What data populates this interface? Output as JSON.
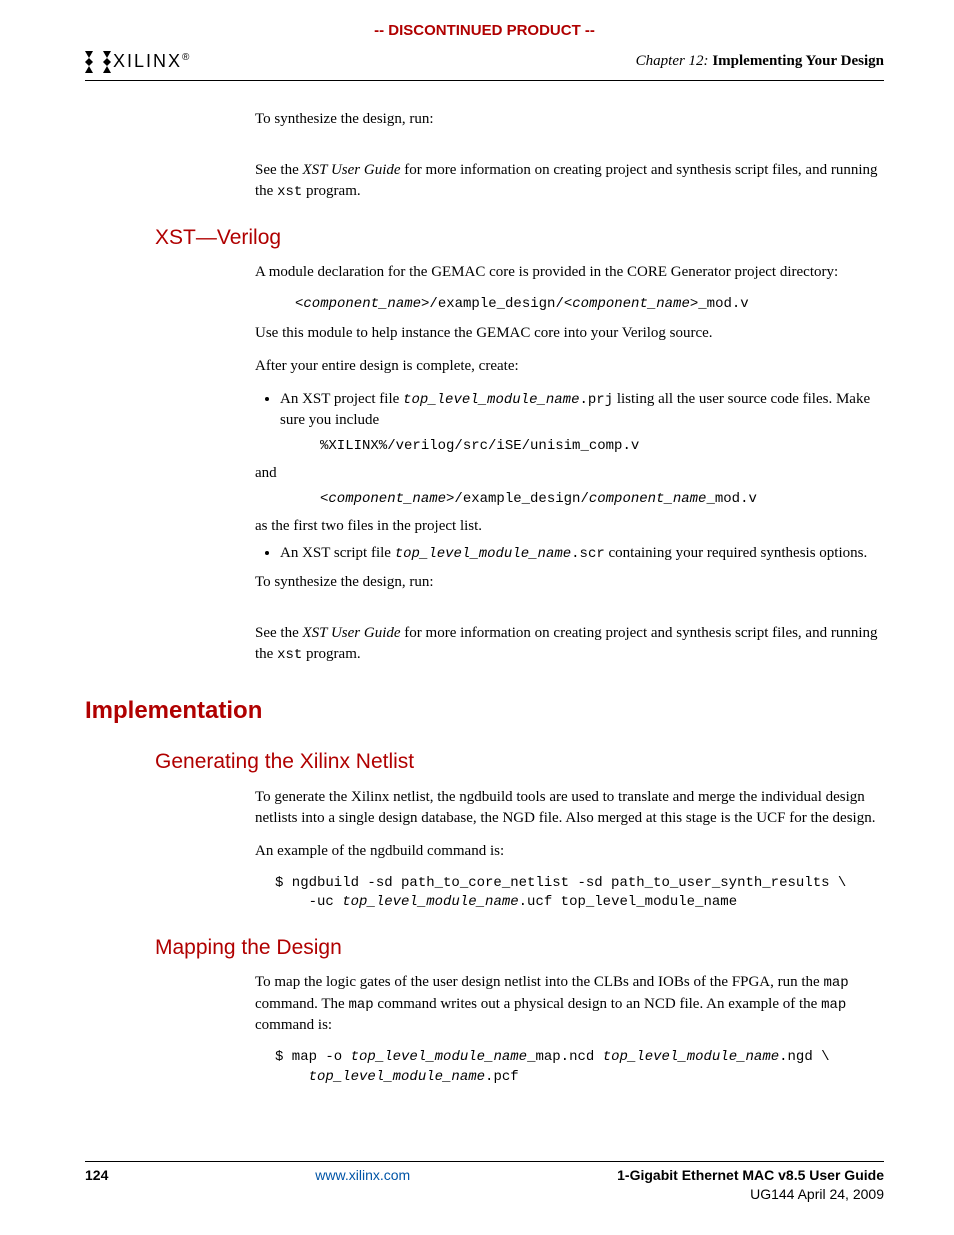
{
  "banner": "-- DISCONTINUED PRODUCT --",
  "logo_text": "XILINX",
  "chapter_prefix": "Chapter 12:",
  "chapter_title": "Implementing Your Design",
  "p_synth_intro": "To synthesize the design, run:",
  "p_xst_guide_prefix": "See the ",
  "p_xst_guide_italic": "XST User Guide",
  "p_xst_guide_mid": " for more information on creating project and synthesis script files, and running the ",
  "p_xst_guide_code": "xst",
  "p_xst_guide_suffix": " program.",
  "h_xst_verilog": "XST—Verilog",
  "p_module_decl": "A module declaration for the GEMAC core is provided in the CORE Generator project directory:",
  "code_comp_path_a": "<component_name>",
  "code_comp_path_b": "/example_design/",
  "code_comp_path_c": "<component_name>",
  "code_comp_path_d": "_mod.v",
  "p_use_module": "Use this module to help instance the GEMAC core into your Verilog source.",
  "p_after_complete": "After your entire design is complete, create:",
  "li1_a": "An XST project file ",
  "li1_code1": "top_level_module_name",
  "li1_code2": ".prj",
  "li1_b": " listing all the user source code files. Make sure you include",
  "code_xilinx_path": "%XILINX%/verilog/src/iSE/unisim_comp.v",
  "p_and": "and",
  "code2_a": "<component_name>",
  "code2_b": "/example_design/",
  "code2_c": "component_name",
  "code2_d": "_mod.v",
  "p_first_two": "as the first two files in the project list.",
  "li2_a": "An XST script file ",
  "li2_code1": "top_level_module_name",
  "li2_code2": ".scr",
  "li2_b": " containing your required synthesis options.",
  "h_implementation": "Implementation",
  "h_gen_netlist": "Generating the Xilinx Netlist",
  "p_gen_netlist": "To generate the Xilinx netlist, the ngdbuild tools are used to translate and merge the individual design netlists into a single design database, the NGD file. Also merged at this stage is the UCF for the design.",
  "p_ngdbuild_ex": "An example of the ngdbuild command is:",
  "code_ngdbuild_l1": "$ ngdbuild -sd path_to_core_netlist -sd path_to_user_synth_results \\",
  "code_ngdbuild_l2a": "-uc ",
  "code_ngdbuild_l2b": "top_level_module_name",
  "code_ngdbuild_l2c": ".ucf top_level_module_name",
  "h_mapping": "Mapping the Design",
  "p_mapping_a": "To map the logic gates of the user design netlist into the CLBs and IOBs of the FPGA, run the ",
  "p_mapping_code": "map",
  "p_mapping_b": " command. The ",
  "p_mapping_c": " command writes out a physical design to an NCD file. An example of the ",
  "p_mapping_d": " command is:",
  "code_map_l1a": "$ map -o ",
  "code_map_l1b": "top_level_module_name",
  "code_map_l1c": "_map.ncd ",
  "code_map_l1d": "top_level_module_name",
  "code_map_l1e": ".ngd \\",
  "code_map_l2a": "top_level_module_name",
  "code_map_l2b": ".pcf",
  "footer": {
    "page_num": "124",
    "url": "www.xilinx.com",
    "doc_title": "1-Gigabit Ethernet MAC v8.5 User Guide",
    "doc_sub": "UG144 April 24, 2009"
  }
}
